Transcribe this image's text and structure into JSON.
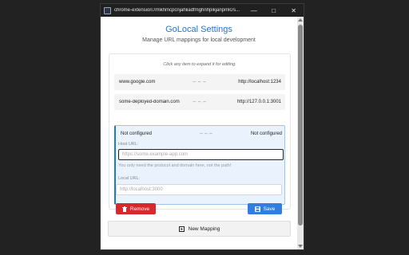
{
  "window": {
    "url": "chrome-extension://mkhmcpcnjahliadfmghnhpikjanpmlc/s...",
    "minimize_glyph": "—",
    "maximize_glyph": "□",
    "close_glyph": "✕"
  },
  "header": {
    "title": "GoLocal Settings",
    "subtitle": "Manage URL mappings for local development"
  },
  "mappings": {
    "hint": "Click any item to expand it for editing.",
    "separator": "⇔⇔⇔",
    "items": [
      {
        "host": "www.google.com",
        "local": "http://localhost:1234"
      },
      {
        "host": "some-deployed-domain.com",
        "local": "http://127.0.0.1:3001"
      }
    ]
  },
  "editor": {
    "host_display": "Not configured",
    "local_display": "Not configured",
    "host_label": "Host URL:",
    "host_placeholder": "https://some.example-app.com",
    "host_help": "You only need the protocol and domain here, not the path!",
    "local_label": "Local URL:",
    "local_placeholder": "http://localhost:3000",
    "remove_label": "Remove",
    "save_label": "Save"
  },
  "footer": {
    "new_mapping_label": "New Mapping"
  },
  "colors": {
    "accent": "#1d78d0",
    "remove": "#d9272e",
    "save": "#2f7fe0"
  }
}
